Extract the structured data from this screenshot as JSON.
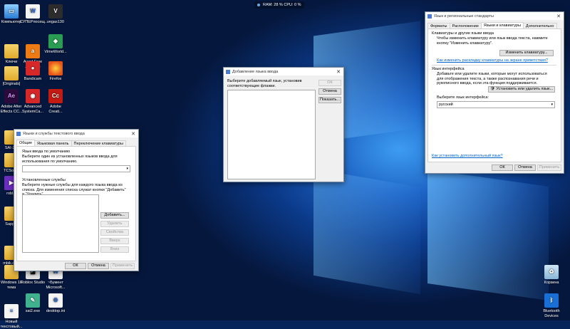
{
  "status_bar": {
    "text": "RAM: 28 %  CPU: 0 %"
  },
  "desktop_left": [
    {
      "label": "Компьютер",
      "icon": "computer-icon",
      "cls": "pc",
      "glyph": "▭"
    },
    {
      "label": "Ключи",
      "icon": "folder-icon",
      "cls": "folder",
      "glyph": ""
    },
    {
      "label": "[Originals]",
      "icon": "folder-icon",
      "cls": "folder",
      "glyph": ""
    },
    {
      "label": "Adobe After Effects CC...",
      "icon": "after-effects-icon",
      "cls": "ae",
      "glyph": "Ae"
    },
    {
      "label": "SAI-2...",
      "icon": "folder-icon",
      "cls": "folder",
      "glyph": ""
    },
    {
      "label": "TCSoft...",
      "icon": "folder-icon",
      "cls": "folder",
      "glyph": ""
    },
    {
      "label": "robl...",
      "icon": "app-icon",
      "cls": "violet",
      "glyph": "▶"
    },
    {
      "label": "Sapp...",
      "icon": "folder-icon",
      "cls": "folder",
      "glyph": ""
    },
    {
      "label": "mbik.co...",
      "icon": "folder-icon",
      "cls": "folder",
      "glyph": ""
    },
    {
      "label": "Windows 10 тема",
      "icon": "folder-icon",
      "cls": "folder",
      "glyph": ""
    },
    {
      "label": "Новый текстовый...",
      "icon": "text-file-icon",
      "cls": "doc",
      "glyph": "≡"
    }
  ],
  "desktop_col2": [
    {
      "label": "СУПЕРпосещ...",
      "icon": "document-icon",
      "cls": "doc",
      "glyph": "W"
    },
    {
      "label": "Avast Free Antivirus",
      "icon": "avast-icon",
      "cls": "orange",
      "glyph": "a"
    },
    {
      "label": "Bandicam",
      "icon": "bandicam-icon",
      "cls": "red",
      "glyph": "●"
    },
    {
      "label": "Advanced SystemCa...",
      "icon": "advanced-systemcare-icon",
      "cls": "red",
      "glyph": "◉"
    },
    {
      "label": "Roblox Studio",
      "icon": "roblox-studio-icon",
      "cls": "roblox",
      "glyph": "◪"
    },
    {
      "label": "sai2.exe",
      "icon": "sai-icon",
      "cls": "teal",
      "glyph": "✎"
    }
  ],
  "desktop_col3": [
    {
      "label": "vegas130",
      "icon": "vegas-icon",
      "cls": "dark",
      "glyph": "V"
    },
    {
      "label": "VimeWorld...",
      "icon": "vimeworld-icon",
      "cls": "green",
      "glyph": "◆"
    },
    {
      "label": "Firefox",
      "icon": "firefox-icon",
      "cls": "ffox",
      "glyph": ""
    },
    {
      "label": "Adobe Creati...",
      "icon": "adobe-cc-icon",
      "cls": "adobe",
      "glyph": "Cc"
    },
    {
      "label": "~Бумент Microsoft...",
      "icon": "document-icon",
      "cls": "doc",
      "glyph": "W"
    },
    {
      "label": "desktop.ini",
      "icon": "settings-file-icon",
      "cls": "doc",
      "glyph": "⚙"
    }
  ],
  "desktop_right": [
    {
      "label": "Корзина",
      "icon": "recycle-bin-icon",
      "cls": "bin",
      "glyph": "♻"
    },
    {
      "label": "Bluetooth Devices",
      "icon": "bluetooth-icon",
      "cls": "bt",
      "glyph": "ᛒ"
    }
  ],
  "text_services": {
    "title": "Языки и службы текстового ввода",
    "close": "✕",
    "tabs": [
      "Общие",
      "Языковая панель",
      "Переключение клавиатуры"
    ],
    "default_group": "Язык ввода по умолчанию",
    "default_desc": "Выберите один из установленных языков ввода для использования по умолчанию.",
    "installed_group": "Установленные службы",
    "installed_desc": "Выберите нужные службы для каждого языка ввода из списка. Для изменения списка служат кнопки \"Добавить\" и \"Удалить\".",
    "buttons": {
      "add": "Добавить...",
      "remove": "Удалить",
      "properties": "Свойства",
      "up": "Вверх",
      "down": "Вниз"
    },
    "ok": "ОК",
    "cancel": "Отмена",
    "apply": "Применить"
  },
  "add_language": {
    "title": "Добавление языка ввода",
    "close": "✕",
    "desc": "Выберите добавляемый язык, установив соответствующие флажки.",
    "ok": "ОК",
    "cancel": "Отмена",
    "preview": "Показать..."
  },
  "regional": {
    "title": "Язык и региональные стандарты",
    "close": "✕",
    "tabs": [
      "Форматы",
      "Расположение",
      "Языки и клавиатуры",
      "Дополнительно"
    ],
    "kb_header": "Клавиатуры и другие языки ввода",
    "kb_desc": "Чтобы изменить клавиатуру или язык ввода текста, нажмите кнопку \"Изменить клавиатуру\".",
    "change_kb": "Изменить клавиатуру...",
    "kb_link": "Как изменить раскладку клавиатуры на экране приветствия?",
    "ui_header": "Язык интерфейса",
    "ui_desc": "Добавьте или удалите языки, которые могут использоваться для отображения текста, а также распознавания речи и рукописного ввода, если эта функция поддерживается.",
    "install_btn": "Установить или удалить язык...",
    "choose_label": "Выберите язык интерфейса:",
    "ui_lang": "русский",
    "more_link": "Как установить дополнительный язык?",
    "ok": "ОК",
    "cancel": "Отмена",
    "apply": "Применить"
  }
}
